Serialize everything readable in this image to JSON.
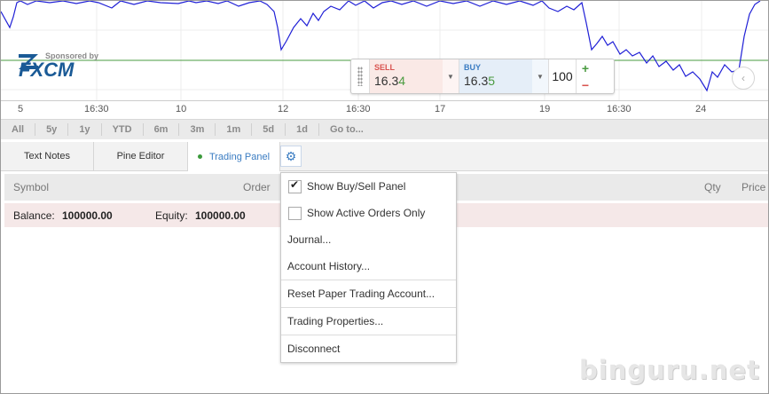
{
  "sponsor": {
    "label": "Sponsored by",
    "brand": "FXCM"
  },
  "trade_widget": {
    "sell": {
      "label": "SELL",
      "price_main": "16.3",
      "price_last": "4"
    },
    "buy": {
      "label": "BUY",
      "price_main": "16.3",
      "price_last": "5"
    },
    "quantity": "100",
    "increase_symbol": "+",
    "decrease_symbol": "−",
    "dropdown_icon": "triangle-down"
  },
  "chart_nav": {
    "scroll_left_icon": "chevron-left"
  },
  "time_axis": {
    "ticks": [
      "5",
      "16:30",
      "10",
      "12",
      "16:30",
      "17",
      "19",
      "16:30",
      "24"
    ]
  },
  "range_bar": {
    "items": [
      "All",
      "5y",
      "1y",
      "YTD",
      "6m",
      "3m",
      "1m",
      "5d",
      "1d",
      "Go to..."
    ]
  },
  "tabs": {
    "items": [
      "Text Notes",
      "Pine Editor",
      "Trading Panel"
    ],
    "active": "Trading Panel",
    "settings_icon": "gear"
  },
  "table": {
    "columns": {
      "symbol": "Symbol",
      "order": "Order",
      "qty": "Qty",
      "price": "Price"
    },
    "balance_label": "Balance:",
    "balance_value": "100000.00",
    "equity_label": "Equity:",
    "equity_value": "100000.00"
  },
  "menu": {
    "items": [
      {
        "label": "Show Buy/Sell Panel",
        "checkbox": true,
        "checked": true
      },
      {
        "label": "Show Active Orders Only",
        "checkbox": true,
        "checked": false
      },
      {
        "label": "Journal..."
      },
      {
        "label": "Account History..."
      },
      {
        "label": "Reset Paper Trading Account..."
      },
      {
        "label": "Trading Properties..."
      },
      {
        "label": "Disconnect"
      }
    ]
  },
  "watermark": "binguru.net",
  "colors": {
    "price_line": "#1f1fd6",
    "horizontal_line": "#4a9b40",
    "sell": "#d9534f",
    "buy": "#3a7cc2",
    "active_tab": "#3a7cc2"
  }
}
